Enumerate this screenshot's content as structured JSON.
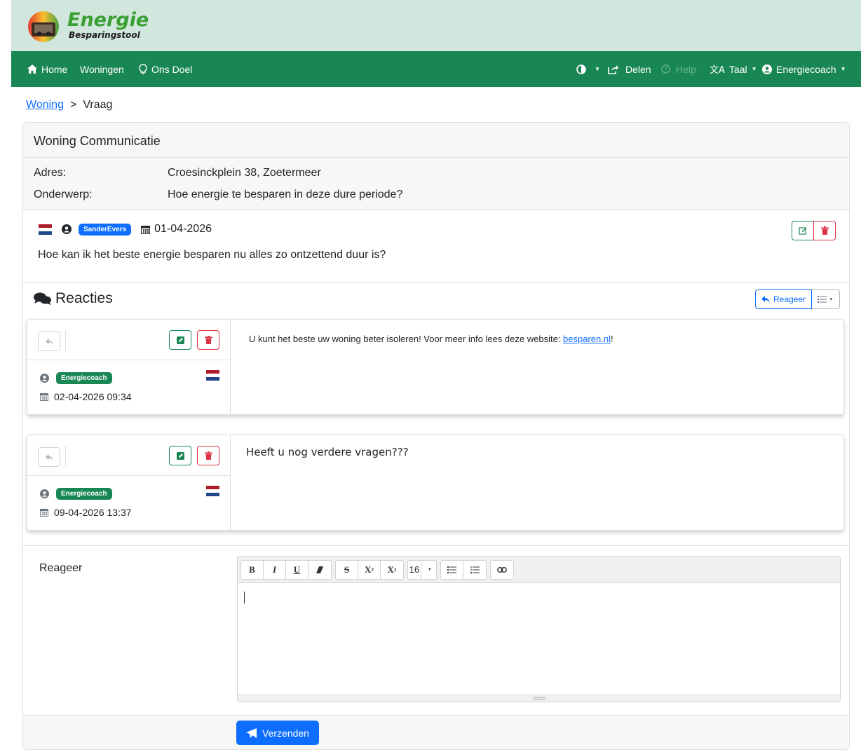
{
  "brand": {
    "title": "Energie",
    "subtitle": "Besparingstool"
  },
  "nav": {
    "home": "Home",
    "woningen": "Woningen",
    "ons_doel": "Ons Doel",
    "delen": "Delen",
    "help": "Help",
    "taal": "Taal",
    "user": "Energiecoach"
  },
  "breadcrumb": {
    "parent": "Woning",
    "separator": ">",
    "current": "Vraag"
  },
  "card": {
    "title": "Woning Communicatie"
  },
  "info": {
    "adres_label": "Adres:",
    "adres_value": "Croesinckplein 38, Zoetermeer",
    "onderwerp_label": "Onderwerp:",
    "onderwerp_value": "Hoe energie te besparen in deze dure periode?"
  },
  "question": {
    "author": "SanderEvers",
    "date": "01-04-2026",
    "text": "Hoe kan ik het beste energie besparen nu alles zo ontzettend duur is?"
  },
  "reacties": {
    "title": "Reacties",
    "reply_button": "Reageer"
  },
  "comments": [
    {
      "author": "Energiecoach",
      "date": "02-04-2026 09:34",
      "text_before": "U kunt het beste uw woning beter isoleren! Voor meer info lees deze website: ",
      "link": "besparen.nl",
      "text_after": "!"
    },
    {
      "author": "Energiecoach",
      "date": "09-04-2026 13:37",
      "text": "Heeft u nog verdere vragen???"
    }
  ],
  "reply_form": {
    "label": "Reageer",
    "font_size": "16",
    "submit": "Verzenden"
  },
  "colors": {
    "brand_green": "#198754",
    "top_band": "#d1e7dd",
    "primary": "#0d6efd",
    "danger": "#dc3545"
  }
}
